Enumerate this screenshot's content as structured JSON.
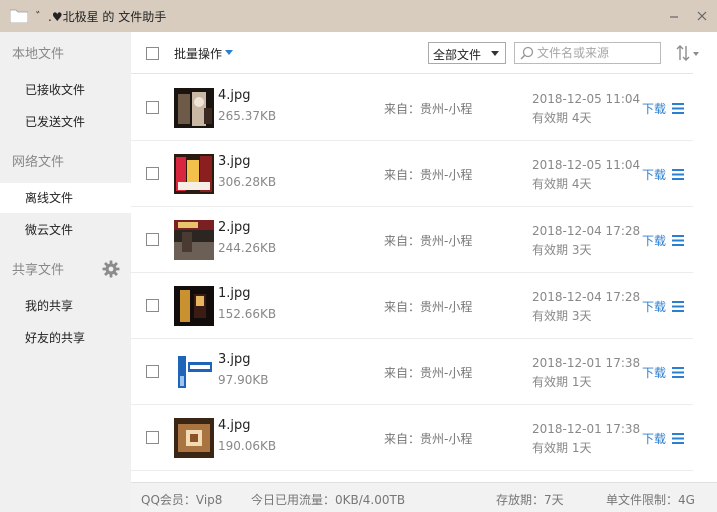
{
  "window": {
    "title": "゛.♥北极星 的 文件助手",
    "minimize_icon": "minimize-icon",
    "close_icon": "close-icon"
  },
  "sidebar": {
    "sections": [
      {
        "label": "本地文件",
        "items": [
          {
            "label": "已接收文件"
          },
          {
            "label": "已发送文件"
          }
        ]
      },
      {
        "label": "网络文件",
        "items": [
          {
            "label": "离线文件",
            "active": true
          },
          {
            "label": "微云文件"
          }
        ]
      },
      {
        "label": "共享文件",
        "items": [
          {
            "label": "我的共享"
          },
          {
            "label": "好友的共享"
          }
        ]
      }
    ]
  },
  "toolbar": {
    "batch_label": "批量操作",
    "filter_value": "全部文件",
    "search_placeholder": "文件名或来源"
  },
  "files": [
    {
      "name": "4.jpg",
      "size": "265.37KB",
      "from": "来自：贵州-小程",
      "date": "2018-12-05 11:04",
      "expiry": "有效期 4天",
      "download": "下载"
    },
    {
      "name": "3.jpg",
      "size": "306.28KB",
      "from": "来自：贵州-小程",
      "date": "2018-12-05 11:04",
      "expiry": "有效期 4天",
      "download": "下载"
    },
    {
      "name": "2.jpg",
      "size": "244.26KB",
      "from": "来自：贵州-小程",
      "date": "2018-12-04 17:28",
      "expiry": "有效期 3天",
      "download": "下载"
    },
    {
      "name": "1.jpg",
      "size": "152.66KB",
      "from": "来自：贵州-小程",
      "date": "2018-12-04 17:28",
      "expiry": "有效期 3天",
      "download": "下载"
    },
    {
      "name": "3.jpg",
      "size": "97.90KB",
      "from": "来自：贵州-小程",
      "date": "2018-12-01 17:38",
      "expiry": "有效期 1天",
      "download": "下载"
    },
    {
      "name": "4.jpg",
      "size": "190.06KB",
      "from": "来自：贵州-小程",
      "date": "2018-12-01 17:38",
      "expiry": "有效期 1天",
      "download": "下载"
    }
  ],
  "footer": {
    "member": "QQ会员：Vip8",
    "traffic": "今日已用流量：0KB/4.00TB",
    "storage": "存放期：7天",
    "limit": "单文件限制：4G"
  },
  "colors": {
    "titlebar": "#d8ccbf",
    "sidebar": "#f0f0f0",
    "link": "#2b7fd1"
  }
}
